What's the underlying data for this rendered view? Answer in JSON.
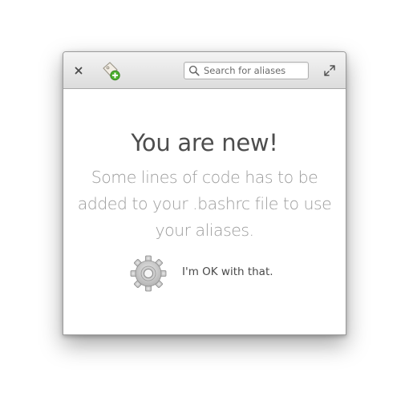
{
  "window": {
    "search_placeholder": "Search for aliases",
    "close_label": "×"
  },
  "main": {
    "title": "You are new!",
    "description_lines": [
      "Some lines of code has to be",
      "added to your .bashrc file to use",
      "your aliases."
    ],
    "ok_label": "I'm OK with that."
  },
  "icons": {
    "close": "close-icon",
    "add": "add-alias-icon",
    "search": "search-icon",
    "maximize": "maximize-icon",
    "gear": "gear-icon"
  },
  "colors": {
    "title": "#4d4d4d",
    "description": "#9c9c9c",
    "add_badge": "#4caf30"
  }
}
